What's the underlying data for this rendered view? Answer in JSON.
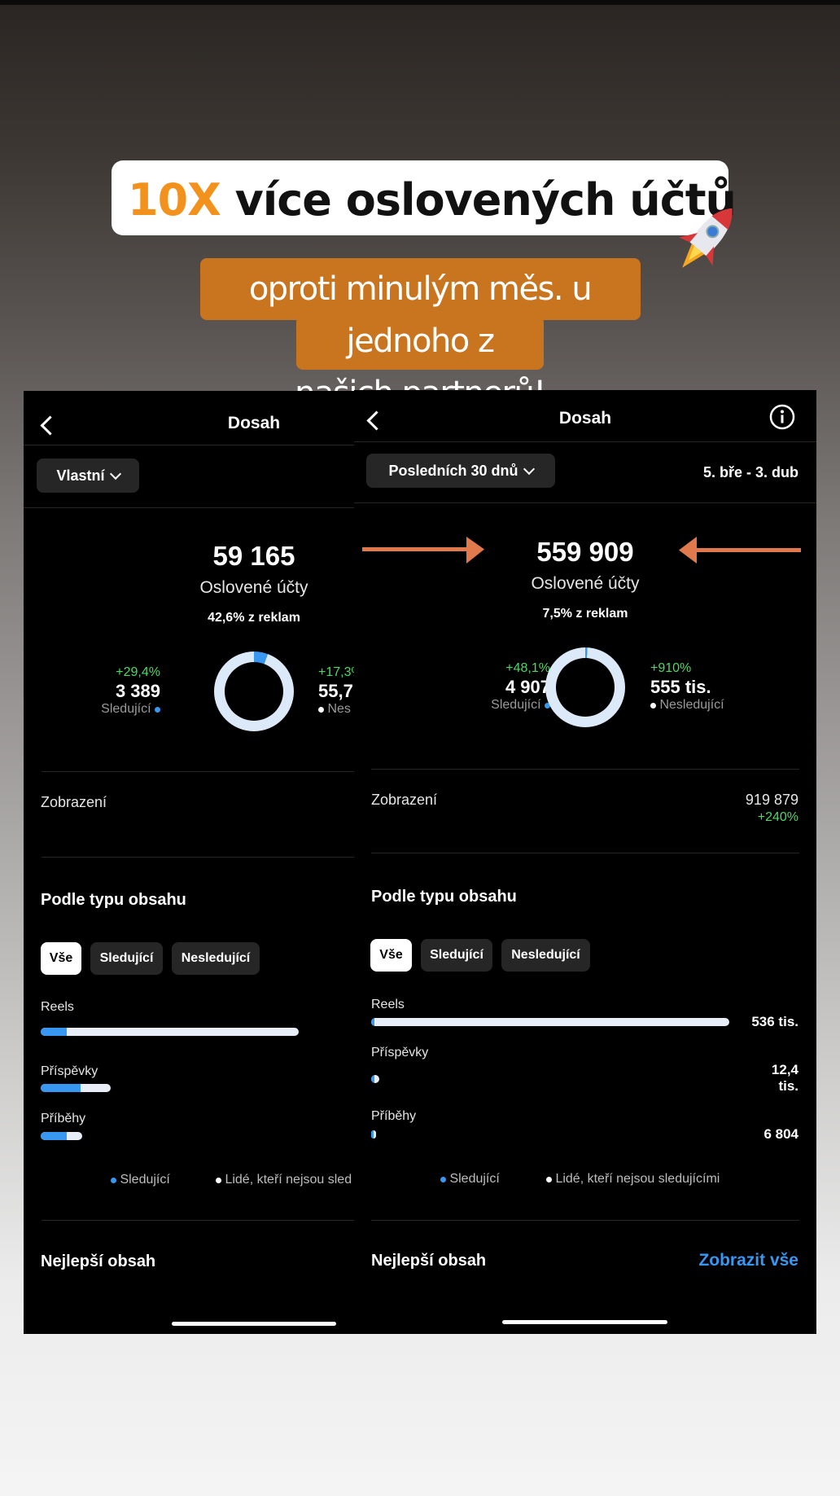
{
  "headline": {
    "accent": "10X",
    "rest": " více oslovených účtů"
  },
  "subheadline": {
    "line1": "oproti minulým měs. u jednoho z",
    "line2": "našich partnerů!"
  },
  "colors": {
    "accent_orange": "#f2921d",
    "sub_bg": "#c9741f",
    "blue": "#3897f0",
    "green": "#4cd964",
    "arrow": "#e07a4c"
  },
  "left": {
    "title": "Dosah",
    "range_filter": "Vlastní",
    "reached": "59 165",
    "reached_label": "Oslovené účty",
    "ads_note": "42,6% z reklam",
    "followers": {
      "change": "+29,4%",
      "value": "3 389",
      "label": "Sledující"
    },
    "nonfollowers": {
      "change": "+17,3%",
      "value": "55,7",
      "label": "Nes"
    },
    "ring_followers_pct": 5.7,
    "impressions_label": "Zobrazení",
    "by_type": "Podle typu obsahu",
    "tabs": [
      "Vše",
      "Sledující",
      "Nesledující"
    ],
    "rows": [
      {
        "label": "Reels",
        "total_frac": 1.0,
        "followers_frac": 0.1
      },
      {
        "label": "Příspěvky",
        "total_frac": 0.27,
        "followers_frac": 0.57
      },
      {
        "label": "Příběhy",
        "total_frac": 0.16,
        "followers_frac": 0.62
      }
    ],
    "legend": {
      "followers": "Sledující",
      "others": "Lidé, kteří nejsou sled"
    },
    "best": "Nejlepší obsah"
  },
  "right": {
    "title": "Dosah",
    "range_filter": "Posledních 30 dnů",
    "date_range": "5. bře - 3. dub",
    "reached": "559 909",
    "reached_label": "Oslovené účty",
    "ads_note": "7,5% z reklam",
    "followers": {
      "change": "+48,1%",
      "value": "4 907",
      "label": "Sledující"
    },
    "nonfollowers": {
      "change": "+910%",
      "value": "555 tis.",
      "label": "Nesledující"
    },
    "ring_followers_pct": 0.9,
    "impressions_label": "Zobrazení",
    "impressions_value": "919 879",
    "impressions_change": "+240%",
    "by_type": "Podle typu obsahu",
    "tabs": [
      "Vše",
      "Sledující",
      "Nesledující"
    ],
    "rows": [
      {
        "label": "Reels",
        "value": "536 tis.",
        "total_frac": 1.0,
        "followers_frac": 0.01
      },
      {
        "label": "Příspěvky",
        "value": "12,4 tis.",
        "total_frac": 0.023,
        "followers_frac": 0.4
      },
      {
        "label": "Příběhy",
        "value": "6 804",
        "total_frac": 0.013,
        "followers_frac": 0.4
      }
    ],
    "legend": {
      "followers": "Sledující",
      "others": "Lidé, kteří nejsou sledujícími"
    },
    "best": "Nejlepší obsah",
    "see_all": "Zobrazit vše"
  }
}
